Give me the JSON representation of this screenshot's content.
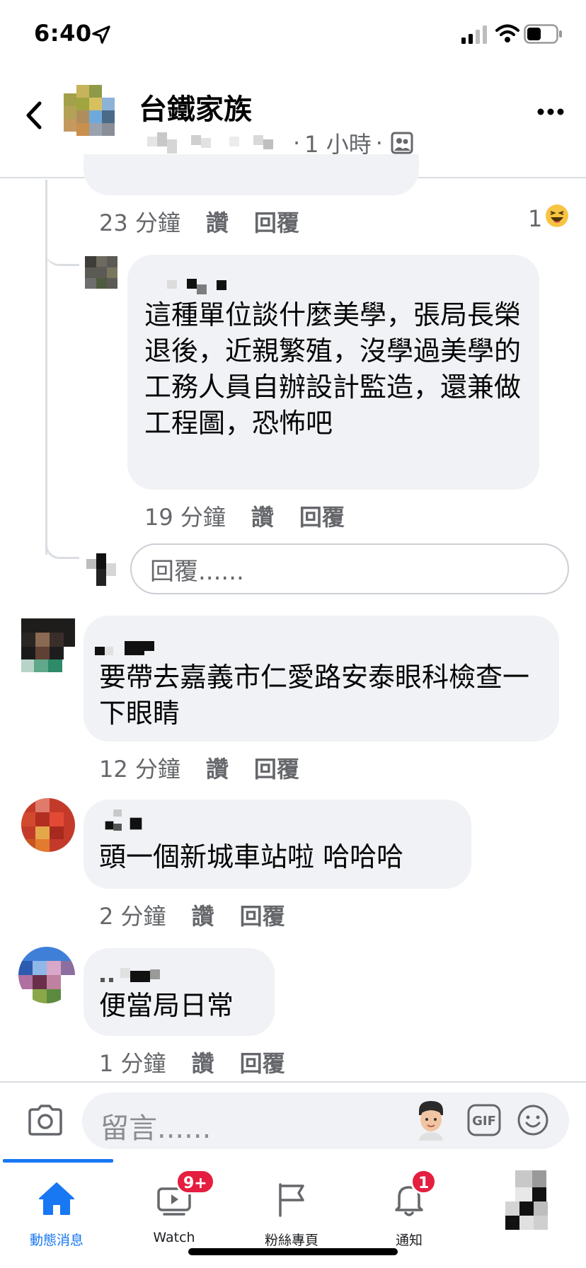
{
  "status_bar": {
    "time": "6:40"
  },
  "header": {
    "group_name": "台鐵家族",
    "post_time": "1 小時",
    "dot": "·"
  },
  "comments": [
    {
      "id": "c0",
      "text": "",
      "time": "23 分鐘",
      "like_label": "讚",
      "reply_label": "回覆",
      "reaction_count": "1",
      "reaction_icon": "haha-icon"
    },
    {
      "id": "c1",
      "text": "這種單位談什麼美學，張局長榮退後，近親繁殖，沒學過美學的工務人員自辦設計監造，還兼做工程圖，恐怖吧",
      "time": "19 分鐘",
      "like_label": "讚",
      "reply_label": "回覆"
    },
    {
      "id": "c2",
      "text": "要帶去嘉義市仁愛路安泰眼科檢查一下眼睛",
      "time": "12 分鐘",
      "like_label": "讚",
      "reply_label": "回覆"
    },
    {
      "id": "c3",
      "text": "頭一個新城車站啦 哈哈哈",
      "time": "2 分鐘",
      "like_label": "讚",
      "reply_label": "回覆"
    },
    {
      "id": "c4",
      "text": "便當局日常",
      "time": "1 分鐘",
      "like_label": "讚",
      "reply_label": "回覆"
    }
  ],
  "reply_box": {
    "placeholder": "回覆......"
  },
  "composer": {
    "placeholder": "留言......",
    "gif_label": "GIF"
  },
  "tabs": [
    {
      "label": "動態消息",
      "icon": "home-icon",
      "active": true
    },
    {
      "label": "Watch",
      "icon": "watch-icon",
      "badge": "9+"
    },
    {
      "label": "粉絲專頁",
      "icon": "flag-icon"
    },
    {
      "label": "通知",
      "icon": "bell-icon",
      "badge": "1"
    },
    {
      "label": "",
      "icon": "profile-menu-icon"
    }
  ],
  "colors": {
    "accent": "#1877f2",
    "badge": "#e41e3f",
    "bubble": "#f0f2f5",
    "meta": "#65676b"
  }
}
